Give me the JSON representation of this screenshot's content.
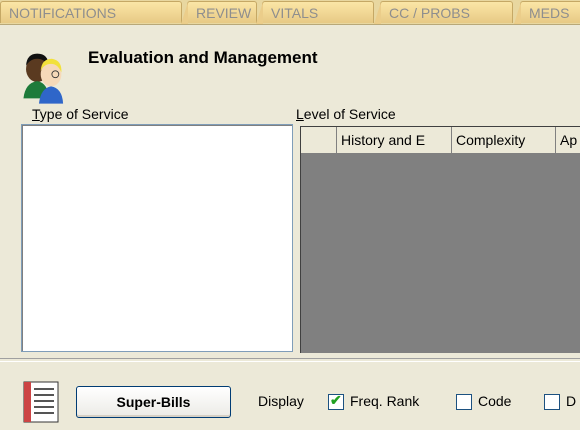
{
  "tabs": [
    "NOTIFICATIONS",
    "REVIEW",
    "VITALS",
    "CC / PROBS",
    "MEDS"
  ],
  "header": {
    "title": "Evaluation and Management"
  },
  "type_of_service": {
    "label_first": "T",
    "label_rest": "ype of Service"
  },
  "level_of_service": {
    "label_first": "L",
    "label_rest": "evel of Service",
    "columns": [
      "",
      "History and E",
      "Complexity",
      "Ap"
    ]
  },
  "footer": {
    "superbills_label": "Super-Bills",
    "display_label": "Display",
    "options": [
      {
        "label": "Freq. Rank",
        "checked": true
      },
      {
        "label": "Code",
        "checked": false
      },
      {
        "label": "D",
        "checked": false
      }
    ]
  },
  "colors": {
    "tab_bg": "#F0D591",
    "check": "#21A121",
    "grid_bg": "#808080"
  }
}
